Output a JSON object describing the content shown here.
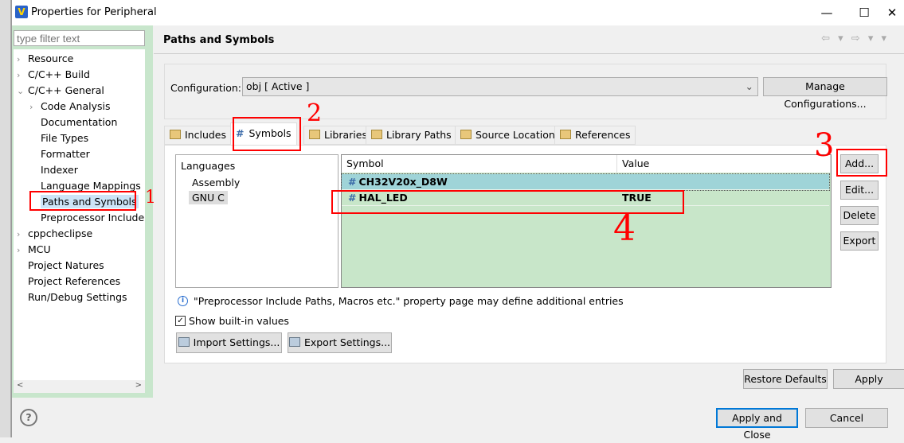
{
  "window": {
    "title": "Properties for Peripheral",
    "minimize": "—",
    "maximize": "☐",
    "close": "✕"
  },
  "filter": {
    "placeholder": "type filter text"
  },
  "tree": [
    {
      "label": "Resource",
      "arrow": "›",
      "level": 0
    },
    {
      "label": "C/C++ Build",
      "arrow": "›",
      "level": 0
    },
    {
      "label": "C/C++ General",
      "arrow": "⌄",
      "level": 0
    },
    {
      "label": "Code Analysis",
      "arrow": "›",
      "level": 1
    },
    {
      "label": "Documentation",
      "arrow": "",
      "level": 1
    },
    {
      "label": "File Types",
      "arrow": "",
      "level": 1
    },
    {
      "label": "Formatter",
      "arrow": "",
      "level": 1
    },
    {
      "label": "Indexer",
      "arrow": "",
      "level": 1
    },
    {
      "label": "Language Mappings",
      "arrow": "",
      "level": 1
    },
    {
      "label": "Paths and Symbols",
      "arrow": "",
      "level": 1,
      "selected": true
    },
    {
      "label": "Preprocessor Include",
      "arrow": "",
      "level": 1
    },
    {
      "label": "cppcheclipse",
      "arrow": "›",
      "level": 0
    },
    {
      "label": "MCU",
      "arrow": "›",
      "level": 0
    },
    {
      "label": "Project Natures",
      "arrow": "",
      "level": 0
    },
    {
      "label": "Project References",
      "arrow": "",
      "level": 0
    },
    {
      "label": "Run/Debug Settings",
      "arrow": "",
      "level": 0
    }
  ],
  "page": {
    "title": "Paths and Symbols",
    "nav": "⇦ ▾ ⇨ ▾ ▾"
  },
  "config": {
    "label": "Configuration:",
    "value": "obj  [ Active ]",
    "manage": "Manage Configurations..."
  },
  "tabs": [
    {
      "label": "Includes"
    },
    {
      "label": "Symbols",
      "active": true
    },
    {
      "label": "Libraries"
    },
    {
      "label": "Library Paths"
    },
    {
      "label": "Source Location"
    },
    {
      "label": "References"
    }
  ],
  "languages": {
    "header": "Languages",
    "items": [
      "Assembly",
      "GNU C"
    ],
    "selected": "GNU C"
  },
  "symbols": {
    "headers": [
      "Symbol",
      "Value"
    ],
    "rows": [
      {
        "symbol": "CH32V20x_D8W",
        "value": ""
      },
      {
        "symbol": "HAL_LED",
        "value": "TRUE"
      }
    ]
  },
  "side_buttons": [
    "Add...",
    "Edit...",
    "Delete",
    "Export"
  ],
  "info": "\"Preprocessor Include Paths, Macros etc.\" property page may define additional entries",
  "show_builtin": {
    "label": "Show built-in values",
    "checked": true
  },
  "import": "Import Settings...",
  "export": "Export Settings...",
  "restore": "Restore Defaults",
  "apply": "Apply",
  "apply_close": "Apply and Close",
  "cancel": "Cancel",
  "annotations": [
    "1",
    "2",
    "3",
    "4"
  ],
  "colors": {
    "accent_green": "#c8e6c9",
    "selected_row": "#9fd4d8",
    "annotation": "#ff0000"
  }
}
